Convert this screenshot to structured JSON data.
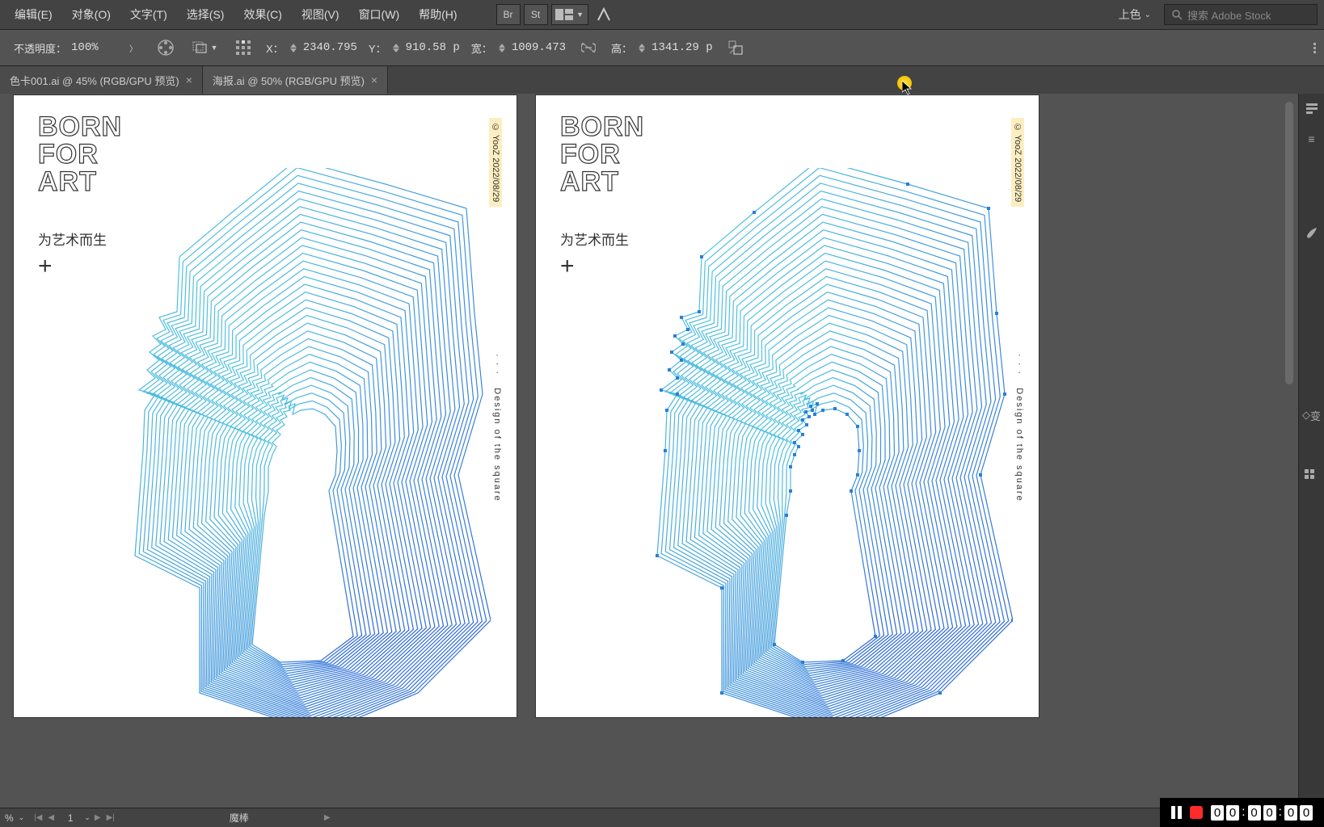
{
  "menu": {
    "items": [
      "编辑(E)",
      "对象(O)",
      "文字(T)",
      "选择(S)",
      "效果(C)",
      "视图(V)",
      "窗口(W)",
      "帮助(H)"
    ],
    "workspace": "上色",
    "search_placeholder": "搜索 Adobe Stock"
  },
  "options": {
    "opacity_label": "不透明度：",
    "opacity_value": "100%",
    "x_label": "X：",
    "x_value": "2340.795",
    "y_label": "Y：",
    "y_value": "910.58 p",
    "w_label": "宽：",
    "w_value": "1009.473",
    "h_label": "高：",
    "h_value": "1341.29 p"
  },
  "tabs": [
    {
      "label": "色卡001.ai @ 45% (RGB/GPU 预览)",
      "active": false
    },
    {
      "label": "海报.ai @ 50% (RGB/GPU 预览)",
      "active": true
    }
  ],
  "poster": {
    "title_l1": "BORN",
    "title_l2": "FOR",
    "title_l3": "ART",
    "subtitle": "为艺术而生",
    "plus": "+",
    "side_top": "© YooZ   2022/08/29",
    "side_dots": "· · ·",
    "side_text": "Design of the square"
  },
  "status": {
    "zoom": "%",
    "page": "1",
    "tool": "魔棒"
  },
  "dock": {
    "label1": "变"
  },
  "recorder": {
    "time_digits": [
      "0",
      "0",
      "0",
      "0",
      "0",
      "0"
    ]
  }
}
